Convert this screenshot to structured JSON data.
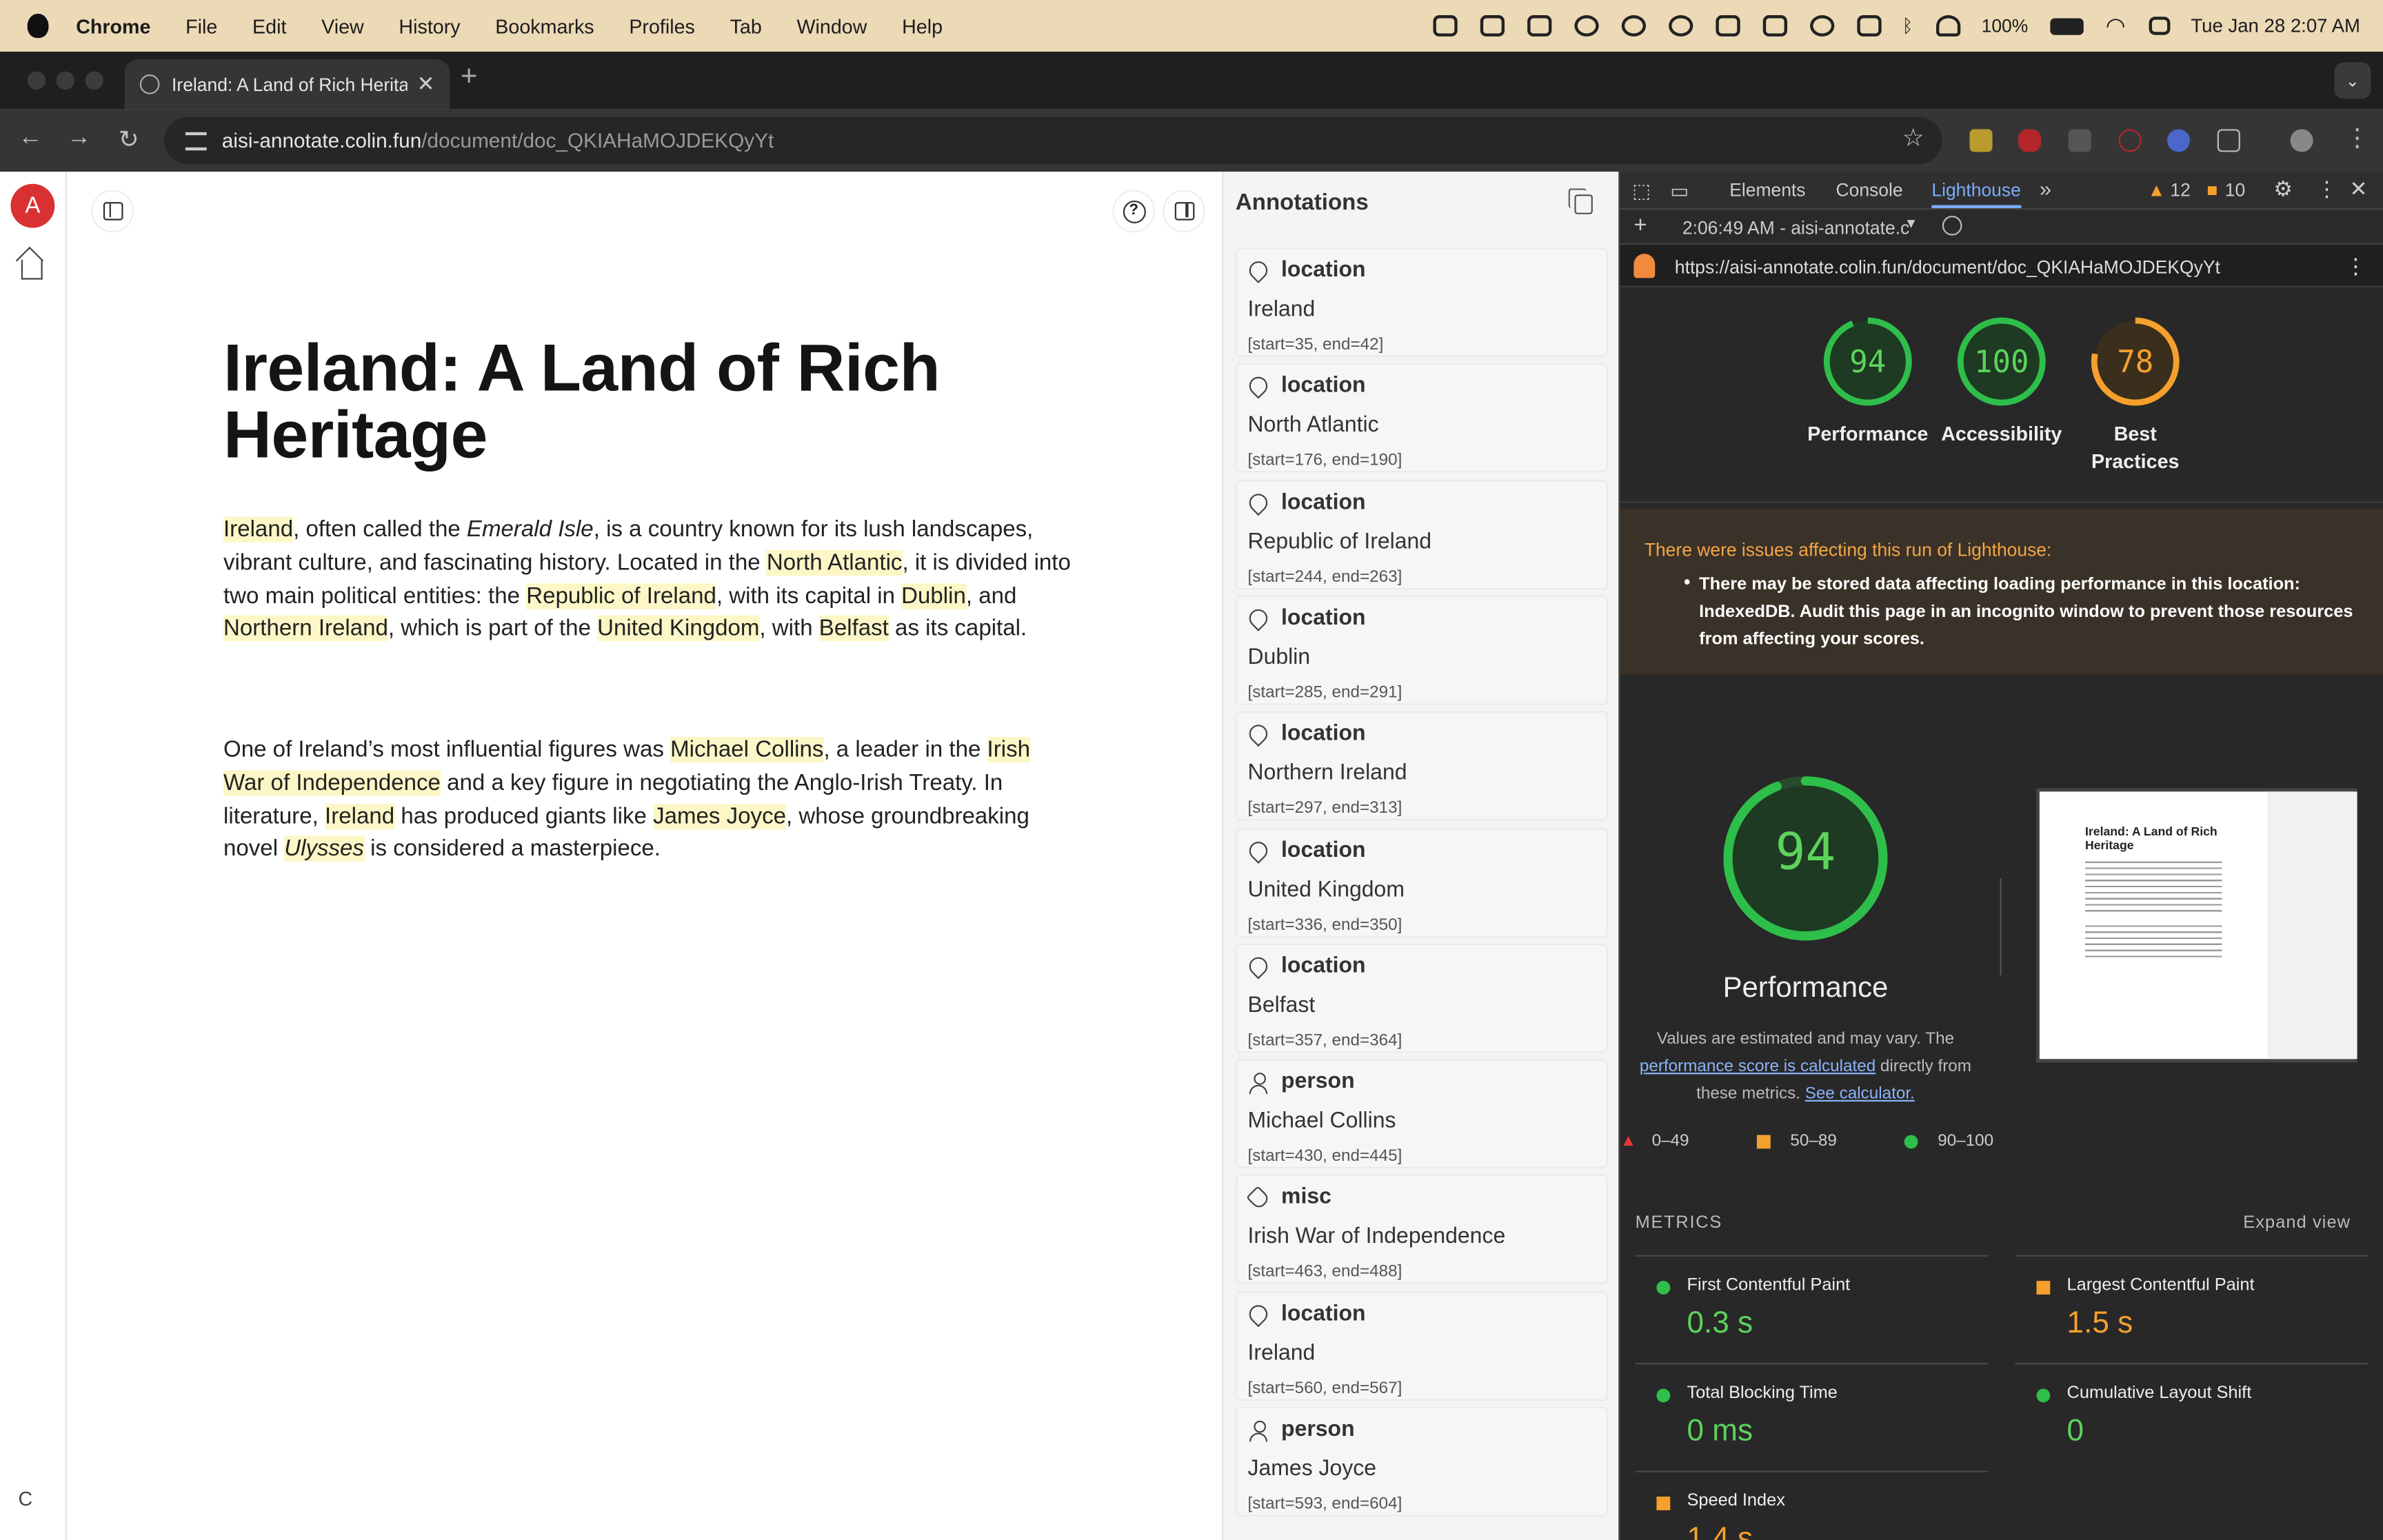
{
  "menubar": {
    "app": "Chrome",
    "items": [
      "File",
      "Edit",
      "View",
      "History",
      "Bookmarks",
      "Profiles",
      "Tab",
      "Window",
      "Help"
    ],
    "battery": "100%",
    "datetime": "Tue Jan 28  2:07 AM"
  },
  "browser": {
    "tab_title": "Ireland: A Land of Rich Herita",
    "url_host": "aisi-annotate.colin.fun",
    "url_path": "/document/doc_QKIAHaMOJDEKQyYt"
  },
  "app": {
    "avatar_letter": "A",
    "bottom_letter": "C"
  },
  "document": {
    "title": "Ireland: A Land of Rich Heritage",
    "p1": [
      {
        "t": "Ireland",
        "hl": true
      },
      {
        "t": ", often called the "
      },
      {
        "t": "Emerald Isle",
        "it": true
      },
      {
        "t": ", is a country known for its lush landscapes, vibrant culture, and fascinating history. Located in the "
      },
      {
        "t": "North Atlantic",
        "hl": true
      },
      {
        "t": ", it is divided into two main political entities: the "
      },
      {
        "t": "Republic of Ireland",
        "hl": true
      },
      {
        "t": ", with its capital in "
      },
      {
        "t": "Dublin",
        "hl": true
      },
      {
        "t": ", and "
      },
      {
        "t": "Northern Ireland",
        "hl": true
      },
      {
        "t": ", which is part of the "
      },
      {
        "t": "United Kingdom",
        "hl": true
      },
      {
        "t": ", with "
      },
      {
        "t": "Belfast",
        "hl": true
      },
      {
        "t": " as its capital."
      }
    ],
    "p2": [
      {
        "t": "One of Ireland’s most influential figures was "
      },
      {
        "t": "Michael Collins",
        "hl": true
      },
      {
        "t": ", a leader in the "
      },
      {
        "t": "Irish War of Independence",
        "hl": true
      },
      {
        "t": " and a key figure in negotiating the Anglo-Irish Treaty. In literature, "
      },
      {
        "t": "Ireland",
        "hl": true
      },
      {
        "t": " has produced giants like "
      },
      {
        "t": "James Joyce",
        "hl": true
      },
      {
        "t": ", whose groundbreaking novel "
      },
      {
        "t": "Ulysses",
        "hl": true,
        "it": true
      },
      {
        "t": " is considered a masterpiece."
      }
    ]
  },
  "annotations": {
    "title": "Annotations",
    "items": [
      {
        "type": "location",
        "icon": "location-pin-icon",
        "value": "Ireland",
        "range": "[start=35, end=42]"
      },
      {
        "type": "location",
        "icon": "location-pin-icon",
        "value": "North Atlantic",
        "range": "[start=176, end=190]"
      },
      {
        "type": "location",
        "icon": "location-pin-icon",
        "value": "Republic of Ireland",
        "range": "[start=244, end=263]"
      },
      {
        "type": "location",
        "icon": "location-pin-icon",
        "value": "Dublin",
        "range": "[start=285, end=291]"
      },
      {
        "type": "location",
        "icon": "location-pin-icon",
        "value": "Northern Ireland",
        "range": "[start=297, end=313]"
      },
      {
        "type": "location",
        "icon": "location-pin-icon",
        "value": "United Kingdom",
        "range": "[start=336, end=350]"
      },
      {
        "type": "location",
        "icon": "location-pin-icon",
        "value": "Belfast",
        "range": "[start=357, end=364]"
      },
      {
        "type": "person",
        "icon": "person-icon",
        "value": "Michael Collins",
        "range": "[start=430, end=445]"
      },
      {
        "type": "misc",
        "icon": "tag-icon",
        "value": "Irish War of Independence",
        "range": "[start=463, end=488]"
      },
      {
        "type": "location",
        "icon": "location-pin-icon",
        "value": "Ireland",
        "range": "[start=560, end=567]"
      },
      {
        "type": "person",
        "icon": "person-icon",
        "value": "James Joyce",
        "range": "[start=593, end=604]"
      }
    ]
  },
  "devtools": {
    "tabs": [
      "Elements",
      "Console",
      "Lighthouse"
    ],
    "warnings": "12",
    "errors": "10",
    "report_time": "2:06:49 AM - aisi-annotate.c",
    "report_url": "https://aisi-annotate.colin.fun/document/doc_QKIAHaMOJDEKQyYt",
    "scores": [
      {
        "label": "Performance",
        "score": 94,
        "color": "#2ebe4a"
      },
      {
        "label": "Accessibility",
        "score": 100,
        "color": "#2ebe4a"
      },
      {
        "label": "Best Practices",
        "score": 78,
        "color": "#f5a02d"
      }
    ],
    "warning_title": "There were issues affecting this run of Lighthouse:",
    "warning_body": "There may be stored data affecting loading performance in this location: IndexedDB. Audit this page in an incognito window to prevent those resources from affecting your scores.",
    "big_score": "94",
    "big_label": "Performance",
    "note_prefix": "Values are estimated and may vary. The",
    "note_link1": "performance score is calculated",
    "note_mid": "directly from these metrics.",
    "note_link2": "See calculator.",
    "legend": [
      "0–49",
      "50–89",
      "90–100"
    ],
    "metrics_title": "METRICS",
    "expand_view": "Expand view",
    "metrics": [
      {
        "name": "First Contentful Paint",
        "value": "0.3 s",
        "status": "good"
      },
      {
        "name": "Largest Contentful Paint",
        "value": "1.5 s",
        "status": "average"
      },
      {
        "name": "Total Blocking Time",
        "value": "0 ms",
        "status": "good"
      },
      {
        "name": "Cumulative Layout Shift",
        "value": "0",
        "status": "good"
      },
      {
        "name": "Speed Index",
        "value": "1.4 s",
        "status": "average"
      }
    ]
  }
}
